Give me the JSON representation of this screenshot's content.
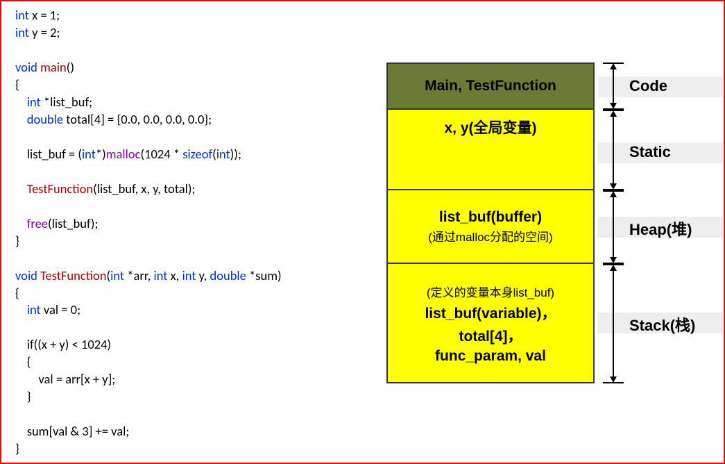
{
  "code": {
    "l1a": "int",
    "l1b": " x = 1;",
    "l2a": "int",
    "l2b": " y = 2;",
    "l4a": "void",
    "l4b": " ",
    "l4c": "main",
    "l4d": "()",
    "l5": "{",
    "l6a": "    int",
    "l6b": " *list_buf;",
    "l7a": "    double",
    "l7b": " total[4] = {0.0, 0.0, 0.0, 0.0};",
    "l9a": "    list_buf = (",
    "l9b": "int",
    "l9c": "*)",
    "l9d": "malloc",
    "l9e": "(1024 * ",
    "l9f": "sizeof",
    "l9g": "(",
    "l9h": "int",
    "l9i": "));",
    "l11a": "    ",
    "l11b": "TestFunction",
    "l11c": "(list_buf, x, y, total);",
    "l13a": "    ",
    "l13b": "free",
    "l13c": "(list_buf);",
    "l14": "}",
    "l16a": "void",
    "l16b": " ",
    "l16c": "TestFunction",
    "l16d": "(",
    "l16e": "int",
    "l16f": " *arr, ",
    "l16g": "int",
    "l16h": " x, ",
    "l16i": "int",
    "l16j": " y, ",
    "l16k": "double",
    "l16l": " *sum)",
    "l17": "{",
    "l18a": "    int",
    "l18b": " val = 0;",
    "l20": "    if((x + y) < 1024)",
    "l21": "    {",
    "l22": "        val = arr[x + y];",
    "l23": "    }",
    "l25": "    sum[val & 3] += val;",
    "l26": "}"
  },
  "memory": {
    "code_seg": "Main, TestFunction",
    "static_seg": "x, y(全局变量)",
    "heap_title": "list_buf(buffer)",
    "heap_sub": "(通过malloc分配的空间)",
    "stack_sub": "(定义的变量本身list_buf)",
    "stack_l1": "list_buf(variable)，",
    "stack_l2": "total[4]，",
    "stack_l3": "func_param, val"
  },
  "labels": {
    "code": "Code",
    "static": "Static",
    "heap": "Heap(堆)",
    "stack": "Stack(栈)"
  }
}
